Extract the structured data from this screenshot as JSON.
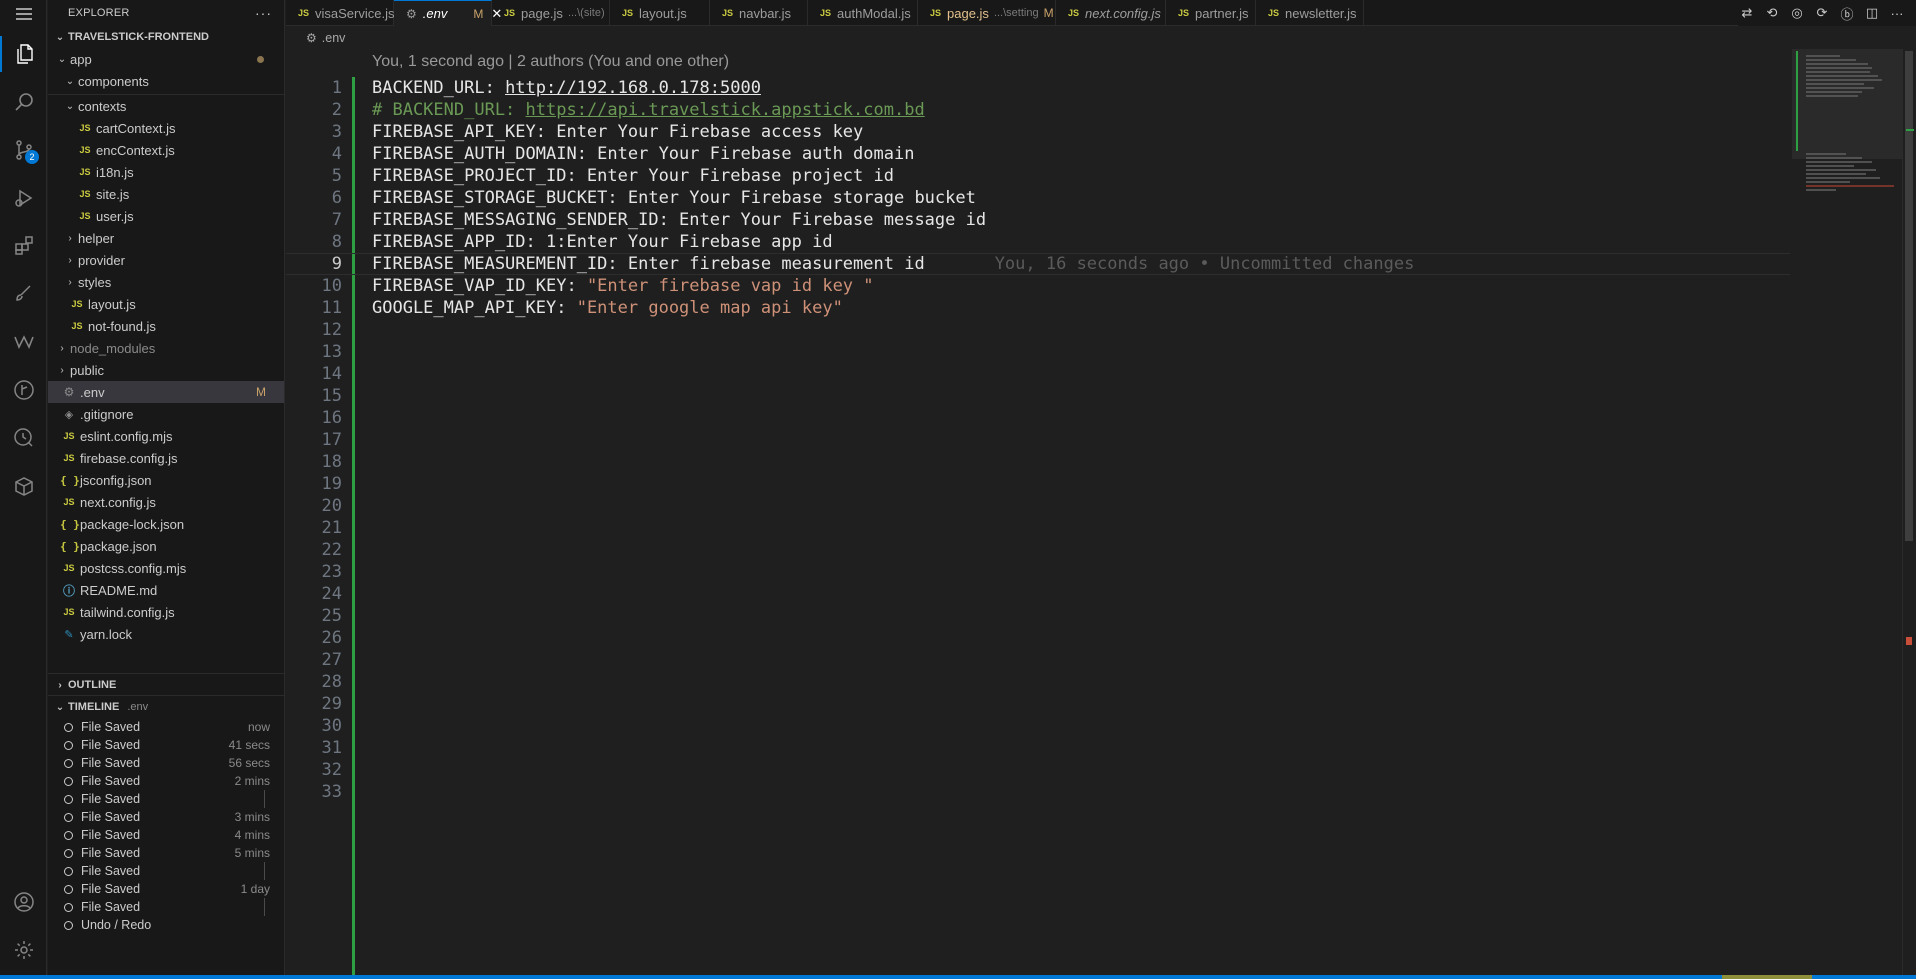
{
  "explorer": {
    "title": "EXPLORER",
    "project": "TRAVELSTICK-FRONTEND",
    "tree": [
      {
        "label": "app",
        "kind": "folder",
        "open": true,
        "depth": 1,
        "dot": true
      },
      {
        "label": "components",
        "kind": "folder",
        "open": true,
        "depth": 2
      },
      {
        "label": "contexts",
        "kind": "folder",
        "open": true,
        "depth": 2
      },
      {
        "label": "cartContext.js",
        "kind": "js",
        "depth": 3
      },
      {
        "label": "encContext.js",
        "kind": "js",
        "depth": 3
      },
      {
        "label": "i18n.js",
        "kind": "js",
        "depth": 3
      },
      {
        "label": "site.js",
        "kind": "js",
        "depth": 3
      },
      {
        "label": "user.js",
        "kind": "js",
        "depth": 3
      },
      {
        "label": "helper",
        "kind": "folder",
        "open": false,
        "depth": 2
      },
      {
        "label": "provider",
        "kind": "folder",
        "open": false,
        "depth": 2
      },
      {
        "label": "styles",
        "kind": "folder",
        "open": false,
        "depth": 2
      },
      {
        "label": "layout.js",
        "kind": "js",
        "depth": 2
      },
      {
        "label": "not-found.js",
        "kind": "js",
        "depth": 2
      },
      {
        "label": "node_modules",
        "kind": "folder",
        "open": false,
        "depth": 1,
        "dim": true
      },
      {
        "label": "public",
        "kind": "folder",
        "open": false,
        "depth": 1
      },
      {
        "label": ".env",
        "kind": "gear",
        "depth": 1,
        "selected": true,
        "mark": "M"
      },
      {
        "label": ".gitignore",
        "kind": "git",
        "depth": 1
      },
      {
        "label": "eslint.config.mjs",
        "kind": "js",
        "depth": 1
      },
      {
        "label": "firebase.config.js",
        "kind": "js",
        "depth": 1
      },
      {
        "label": "jsconfig.json",
        "kind": "json",
        "depth": 1
      },
      {
        "label": "next.config.js",
        "kind": "js",
        "depth": 1
      },
      {
        "label": "package-lock.json",
        "kind": "json",
        "depth": 1
      },
      {
        "label": "package.json",
        "kind": "json",
        "depth": 1
      },
      {
        "label": "postcss.config.mjs",
        "kind": "js",
        "depth": 1
      },
      {
        "label": "README.md",
        "kind": "info",
        "depth": 1
      },
      {
        "label": "tailwind.config.js",
        "kind": "js",
        "depth": 1
      },
      {
        "label": "yarn.lock",
        "kind": "yarn",
        "depth": 1
      }
    ]
  },
  "outline": {
    "title": "OUTLINE"
  },
  "timeline": {
    "title": "TIMELINE",
    "file": ".env",
    "entries": [
      {
        "label": "File Saved",
        "time": "now"
      },
      {
        "label": "File Saved",
        "time": "41 secs"
      },
      {
        "label": "File Saved",
        "time": "56 secs"
      },
      {
        "label": "File Saved",
        "time": "2 mins"
      },
      {
        "label": "File Saved",
        "time": ""
      },
      {
        "label": "File Saved",
        "time": "3 mins"
      },
      {
        "label": "File Saved",
        "time": "4 mins"
      },
      {
        "label": "File Saved",
        "time": "5 mins"
      },
      {
        "label": "File Saved",
        "time": ""
      },
      {
        "label": "File Saved",
        "time": "1 day"
      },
      {
        "label": "File Saved",
        "time": ""
      },
      {
        "label": "Undo / Redo",
        "time": ""
      }
    ]
  },
  "tabs": [
    {
      "label": "visaService.js",
      "icon": "js"
    },
    {
      "label": ".env",
      "icon": "gear",
      "active": true,
      "modified": "M",
      "italic": true
    },
    {
      "label": "page.js",
      "icon": "js",
      "desc": "...\\(site)"
    },
    {
      "label": "layout.js",
      "icon": "js"
    },
    {
      "label": "navbar.js",
      "icon": "js"
    },
    {
      "label": "authModal.js",
      "icon": "js"
    },
    {
      "label": "page.js",
      "icon": "js",
      "desc": "...\\setting",
      "modified": "M",
      "nameModified": true
    },
    {
      "label": "next.config.js",
      "icon": "js",
      "italic": true
    },
    {
      "label": "partner.js",
      "icon": "js"
    },
    {
      "label": "newsletter.js",
      "icon": "js"
    }
  ],
  "breadcrumb": {
    "file": ".env"
  },
  "editor": {
    "codelens": "You, 1 second ago | 2 authors (You and one other)",
    "current_line": 9,
    "blame": "You, 16 seconds ago • Uncommitted changes",
    "lines": [
      [
        {
          "t": "BACKEND_URL: "
        },
        {
          "t": "http://192.168.0.178:5000",
          "c": "url"
        }
      ],
      [
        {
          "t": "# BACKEND_URL: ",
          "c": "comment"
        },
        {
          "t": "https://api.travelstick.appstick.com.bd",
          "c": "comment-url"
        }
      ],
      [
        {
          "t": "FIREBASE_API_KEY: Enter Your Firebase access key"
        }
      ],
      [
        {
          "t": "FIREBASE_AUTH_DOMAIN: Enter Your Firebase auth domain"
        }
      ],
      [
        {
          "t": "FIREBASE_PROJECT_ID: Enter Your Firebase project id"
        }
      ],
      [
        {
          "t": "FIREBASE_STORAGE_BUCKET: Enter Your Firebase storage bucket"
        }
      ],
      [
        {
          "t": "FIREBASE_MESSAGING_SENDER_ID: Enter Your Firebase message id"
        }
      ],
      [
        {
          "t": "FIREBASE_APP_ID: 1:Enter Your Firebase app id"
        }
      ],
      [
        {
          "t": "FIREBASE_MEASUREMENT_ID: Enter firebase measurement id"
        }
      ],
      [
        {
          "t": "FIREBASE_VAP_ID_KEY: "
        },
        {
          "t": "\"Enter firebase vap id key \"",
          "c": "str"
        }
      ],
      [
        {
          "t": "GOOGLE_MAP_API_KEY: "
        },
        {
          "t": "\"Enter google map api key\"",
          "c": "str"
        }
      ]
    ],
    "line_numbers": [
      "1",
      "2",
      "3",
      "4",
      "5",
      "6",
      "7",
      "8",
      "9",
      "10",
      "11",
      "12",
      "13",
      "14",
      "15",
      "16",
      "17",
      "18",
      "19",
      "20",
      "21",
      "22",
      "23",
      "24",
      "25",
      "26",
      "27",
      "28",
      "29",
      "30",
      "31",
      "32",
      "33"
    ]
  },
  "activity": {
    "icons": [
      "menu-icon",
      "files-icon",
      "search-icon",
      "source-control-icon",
      "run-debug-icon",
      "extensions-icon",
      "paint-icon",
      "wave-icon",
      "git-graph-icon",
      "timeline-icon",
      "package-icon",
      "account-icon",
      "settings-icon"
    ],
    "scm_badge": "2"
  },
  "colors": {
    "accent": "#0078d4",
    "added": "#2ea043",
    "modified": "#c9a26a",
    "string": "#ce9178",
    "comment": "#6a9955"
  }
}
